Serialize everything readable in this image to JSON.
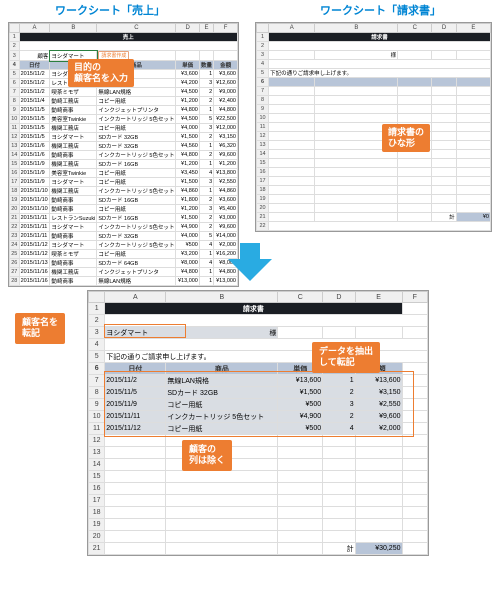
{
  "top": {
    "left_title": "ワークシート「売上」",
    "right_title": "ワークシート「請求書」"
  },
  "sales": {
    "cols": [
      "",
      "A",
      "B",
      "C",
      "D",
      "E",
      "F"
    ],
    "title": "売上",
    "filter_label": "顧客",
    "filter_value": "ヨシダマート",
    "filter_button": "請求書作成",
    "headers": {
      "a": "日付",
      "b": "顧客",
      "c": "商品",
      "d": "単価",
      "e": "数量",
      "f": "金額"
    },
    "rows": [
      {
        "a": "2015/11/2",
        "b": "ヨシダマート",
        "c": "無線LAN規格",
        "d": "¥3,600",
        "e": "1",
        "f": "¥3,600"
      },
      {
        "a": "2015/11/2",
        "b": "レストランSuzuki",
        "c": "コピー用紙",
        "d": "¥4,200",
        "e": "3",
        "f": "¥12,600"
      },
      {
        "a": "2015/11/2",
        "b": "喫茶ミモザ",
        "c": "無線LAN規格",
        "d": "¥4,500",
        "e": "2",
        "f": "¥9,000"
      },
      {
        "a": "2015/11/4",
        "b": "動崎工務店",
        "c": "コピー用紙",
        "d": "¥1,200",
        "e": "2",
        "f": "¥2,400"
      },
      {
        "a": "2015/11/5",
        "b": "動崎商事",
        "c": "インクジェットプリンタ",
        "d": "¥4,800",
        "e": "1",
        "f": "¥4,800"
      },
      {
        "a": "2015/11/5",
        "b": "美容室Twinkie",
        "c": "インクカートリッジ 5色セット",
        "d": "¥4,500",
        "e": "5",
        "f": "¥22,500"
      },
      {
        "a": "2015/11/5",
        "b": "機関工務店",
        "c": "コピー用紙",
        "d": "¥4,000",
        "e": "3",
        "f": "¥12,000"
      },
      {
        "a": "2015/11/5",
        "b": "ヨシダマート",
        "c": "SDカード 32GB",
        "d": "¥1,500",
        "e": "2",
        "f": "¥3,150"
      },
      {
        "a": "2015/11/6",
        "b": "機関工務店",
        "c": "SDカード 32GB",
        "d": "¥4,560",
        "e": "1",
        "f": "¥6,320"
      },
      {
        "a": "2015/11/6",
        "b": "動崎商事",
        "c": "インクカートリッジ 5色セット",
        "d": "¥4,800",
        "e": "2",
        "f": "¥9,600"
      },
      {
        "a": "2015/11/9",
        "b": "機関工務店",
        "c": "SDカード 16GB",
        "d": "¥1,200",
        "e": "1",
        "f": "¥1,200"
      },
      {
        "a": "2015/11/9",
        "b": "美容室Twinkie",
        "c": "コピー用紙",
        "d": "¥3,450",
        "e": "4",
        "f": "¥13,800"
      },
      {
        "a": "2015/11/9",
        "b": "ヨシダマート",
        "c": "コピー用紙",
        "d": "¥1,500",
        "e": "3",
        "f": "¥2,550"
      },
      {
        "a": "2015/11/10",
        "b": "機関工務店",
        "c": "インクカートリッジ 5色セット",
        "d": "¥4,860",
        "e": "1",
        "f": "¥4,860"
      },
      {
        "a": "2015/11/10",
        "b": "動崎商事",
        "c": "SDカード 16GB",
        "d": "¥1,800",
        "e": "2",
        "f": "¥3,600"
      },
      {
        "a": "2015/11/10",
        "b": "動崎商事",
        "c": "コピー用紙",
        "d": "¥1,200",
        "e": "3",
        "f": "¥5,400"
      },
      {
        "a": "2015/11/11",
        "b": "レストランSuzuki",
        "c": "SDカード 16GB",
        "d": "¥1,500",
        "e": "2",
        "f": "¥3,000"
      },
      {
        "a": "2015/11/11",
        "b": "ヨシダマート",
        "c": "インクカートリッジ 5色セット",
        "d": "¥4,900",
        "e": "2",
        "f": "¥9,600"
      },
      {
        "a": "2015/11/11",
        "b": "動崎商事",
        "c": "SDカード 32GB",
        "d": "¥4,000",
        "e": "5",
        "f": "¥14,000"
      },
      {
        "a": "2015/11/12",
        "b": "ヨシダマート",
        "c": "インクカートリッジ 5色セット",
        "d": "¥500",
        "e": "4",
        "f": "¥2,000"
      },
      {
        "a": "2015/11/12",
        "b": "喫茶ミモザ",
        "c": "コピー用紙",
        "d": "¥3,200",
        "e": "1",
        "f": "¥16,200"
      },
      {
        "a": "2015/11/13",
        "b": "動崎商事",
        "c": "SDカード 64GB",
        "d": "¥8,000",
        "e": "4",
        "f": "¥8,000"
      },
      {
        "a": "2015/11/16",
        "b": "機関工務店",
        "c": "インクジェットプリンタ",
        "d": "¥4,800",
        "e": "1",
        "f": "¥4,800"
      },
      {
        "a": "2015/11/16",
        "b": "動崎商事",
        "c": "無線LAN規格",
        "d": "¥13,000",
        "e": "1",
        "f": "¥13,000"
      }
    ]
  },
  "invoice_template": {
    "cols": [
      "",
      "A",
      "B",
      "C",
      "D",
      "E"
    ],
    "title": "請求書",
    "honorific": "様",
    "note": "下記の通りご請求申し上げます。",
    "total_label": "計",
    "total_value": "¥0"
  },
  "invoice_filled": {
    "cols": [
      "",
      "A",
      "B",
      "C",
      "D",
      "E",
      "F"
    ],
    "title": "請求書",
    "customer": "ヨシダマート",
    "honorific": "様",
    "note": "下記の通りご請求申し上げます。",
    "headers": {
      "a": "日付",
      "b": "商品",
      "c": "単価",
      "d": "数量",
      "e": "金額"
    },
    "rows": [
      {
        "a": "2015/11/2",
        "b": "無線LAN規格",
        "c": "¥13,600",
        "d": "1",
        "e": "¥13,600"
      },
      {
        "a": "2015/11/5",
        "b": "SDカード 32GB",
        "c": "¥1,500",
        "d": "2",
        "e": "¥3,150"
      },
      {
        "a": "2015/11/9",
        "b": "コピー用紙",
        "c": "¥500",
        "d": "3",
        "e": "¥2,550"
      },
      {
        "a": "2015/11/11",
        "b": "インクカートリッジ 5色セット",
        "c": "¥4,900",
        "d": "2",
        "e": "¥9,600"
      },
      {
        "a": "2015/11/12",
        "b": "コピー用紙",
        "c": "¥500",
        "d": "4",
        "e": "¥2,000"
      }
    ],
    "total_label": "計",
    "total_value": "¥30,250"
  },
  "callouts": {
    "input_customer": "目的の\n顧客名を入力",
    "template": "請求書の\nひな形",
    "transfer_name": "顧客名を\n転記",
    "extract_data": "データを抽出\nして転記",
    "exclude_col": "顧客の\n列は除く"
  }
}
